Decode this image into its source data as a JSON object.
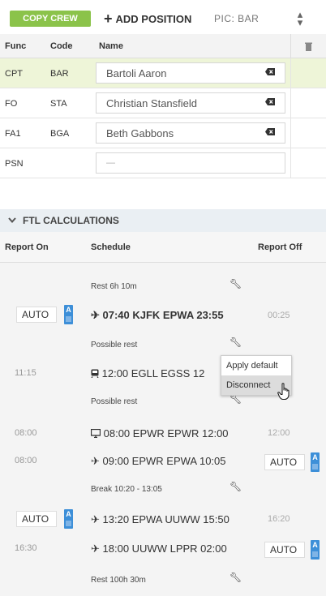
{
  "toolbar": {
    "copy_crew": "COPY CREW",
    "add_position": "ADD POSITION",
    "pic": "PIC: BAR"
  },
  "crew_table": {
    "headers": {
      "func": "Func",
      "code": "Code",
      "name": "Name"
    },
    "rows": [
      {
        "func": "CPT",
        "code": "BAR",
        "name": "Bartoli Aaron",
        "selected": true
      },
      {
        "func": "FO",
        "code": "STA",
        "name": "Christian Stansfield",
        "selected": false
      },
      {
        "func": "FA1",
        "code": "BGA",
        "name": "Beth Gabbons",
        "selected": false
      },
      {
        "func": "PSN",
        "code": "",
        "name": "—",
        "selected": false
      }
    ]
  },
  "ftl": {
    "title": "FTL CALCULATIONS",
    "headers": {
      "report_on": "Report On",
      "schedule": "Schedule",
      "report_off": "Report Off"
    },
    "rest1": "Rest 6h 10m",
    "r1": {
      "left": "AUTO",
      "badge": "A",
      "flight": "07:40 KJFK EPWA 23:55",
      "right": "00:25"
    },
    "possible1": "Possible rest",
    "r2": {
      "left": "11:15",
      "flight": "12:00 EGLL EGSS 12"
    },
    "possible2": "Possible rest",
    "r3": {
      "left": "08:00",
      "flight": "08:00 EPWR EPWR 12:00",
      "right": "12:00"
    },
    "r4": {
      "left": "08:00",
      "flight": "09:00 EPWR EPWA 10:05",
      "right": "AUTO",
      "badge": "A"
    },
    "break1": "Break 10:20 - 13:05",
    "r5": {
      "left": "AUTO",
      "badge": "A",
      "flight": "13:20 EPWA UUWW 15:50",
      "right": "16:20"
    },
    "r6": {
      "left": "16:30",
      "flight": "18:00 UUWW LPPR 02:00",
      "right": "AUTO",
      "badge": "A"
    },
    "rest2": "Rest 100h 30m"
  },
  "context_menu": {
    "apply_default": "Apply default",
    "disconnect": "Disconnect"
  },
  "colors": {
    "accent": "#8bc34a",
    "badge": "#3d8fd8",
    "selected_row": "#eef5d8"
  }
}
